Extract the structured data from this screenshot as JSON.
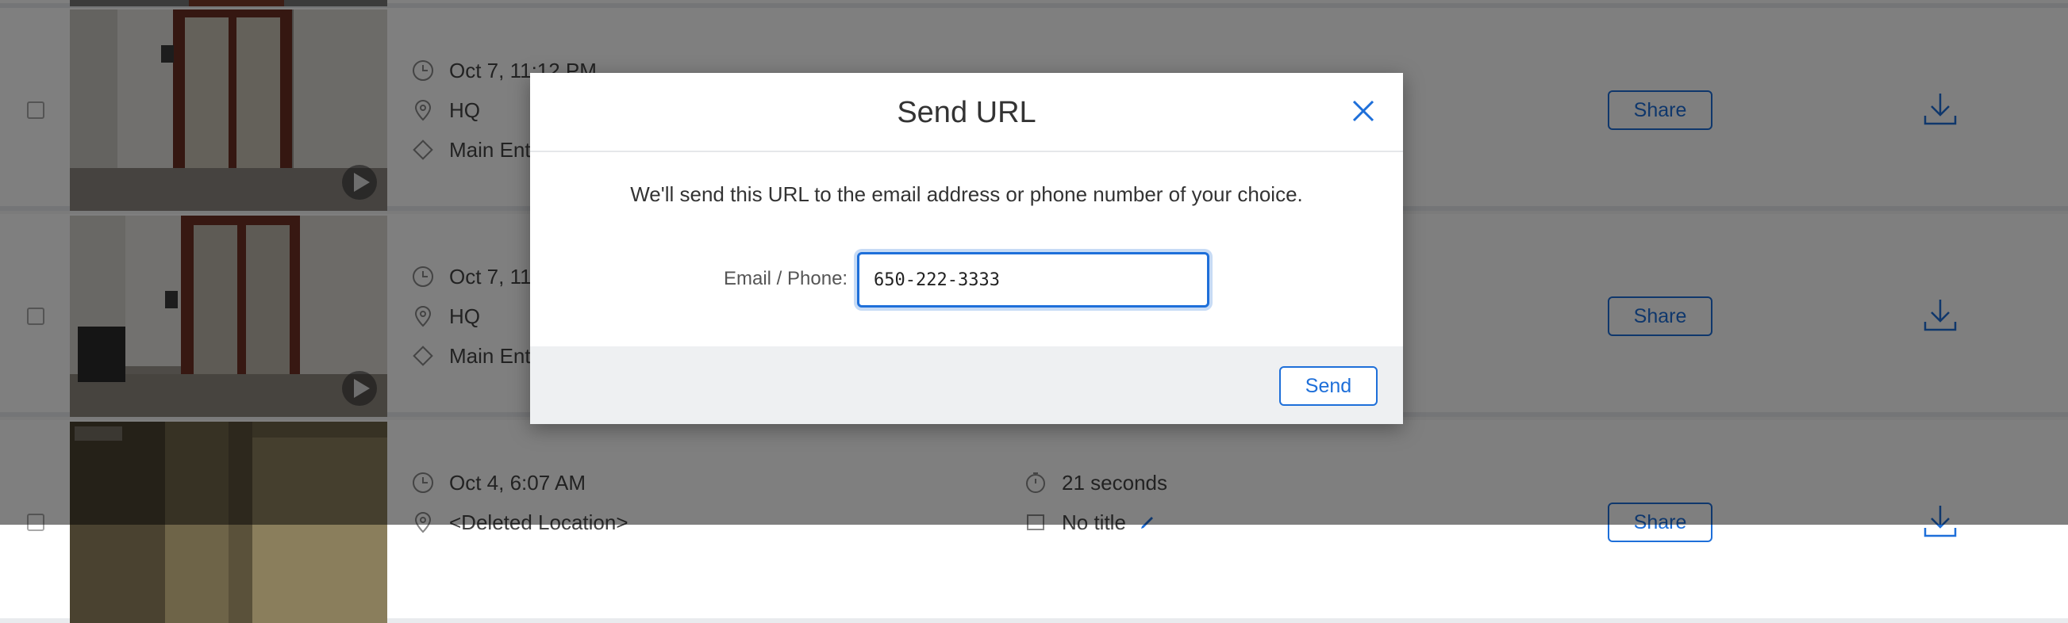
{
  "rows": [
    {
      "time": "Oct 7, 11:12 PM",
      "location": "HQ",
      "camera": "Main Entrance",
      "share_label": "Share"
    },
    {
      "time": "Oct 7, 11:11 PM",
      "location": "HQ",
      "camera": "Main Entrance",
      "share_label": "Share"
    },
    {
      "time": "Oct 4, 6:07 AM",
      "location": "<Deleted Location>",
      "duration": "21 seconds",
      "title": "No title",
      "share_label": "Share"
    }
  ],
  "modal": {
    "title": "Send URL",
    "message": "We'll send this URL to the email address or phone number of your choice.",
    "field_label": "Email / Phone:",
    "field_value": "650-222-3333",
    "send_label": "Send"
  },
  "colors": {
    "accent": "#1e6fd9",
    "overlay": "rgba(0,0,0,0.5)"
  }
}
